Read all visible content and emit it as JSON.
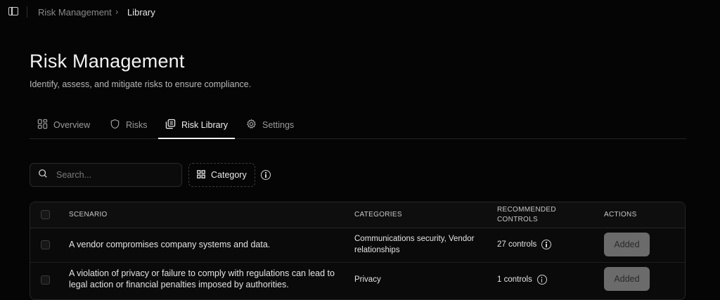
{
  "breadcrumb": {
    "items": [
      "Risk Management",
      "Library"
    ],
    "separator": "›"
  },
  "page": {
    "title": "Risk Management",
    "subtitle": "Identify, assess, and mitigate risks to ensure compliance."
  },
  "tabs": [
    {
      "label": "Overview",
      "icon": "grid-icon",
      "active": false
    },
    {
      "label": "Risks",
      "icon": "shield-icon",
      "active": false
    },
    {
      "label": "Risk Library",
      "icon": "library-icon",
      "active": true
    },
    {
      "label": "Settings",
      "icon": "gear-icon",
      "active": false
    }
  ],
  "filters": {
    "search_placeholder": "Search...",
    "category_label": "Category"
  },
  "table": {
    "columns": [
      "SCENARIO",
      "CATEGORIES",
      "RECOMMENDED CONTROLS",
      "ACTIONS"
    ],
    "rows": [
      {
        "scenario": "A vendor compromises company systems and data.",
        "categories": "Communications security, Vendor relationships",
        "controls": "27 controls",
        "action": "Added"
      },
      {
        "scenario": "A violation of privacy or failure to comply with regulations can lead to legal action or financial penalties imposed by authorities.",
        "categories": "Privacy",
        "controls": "1 controls",
        "action": "Added"
      }
    ]
  },
  "colors": {
    "background": "#050505",
    "border": "#262626",
    "added_button": "#6b6b6b"
  }
}
